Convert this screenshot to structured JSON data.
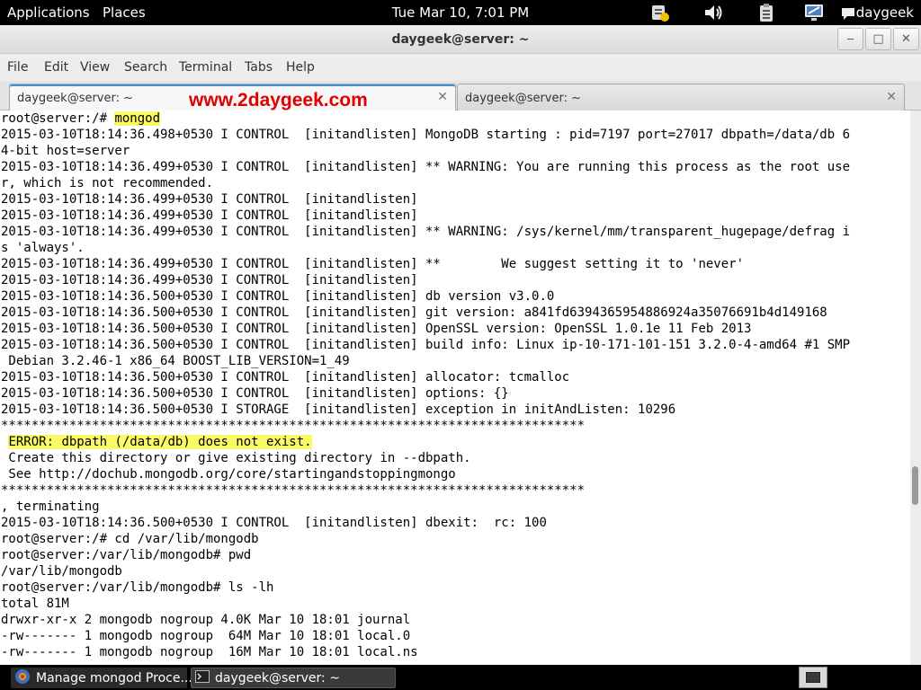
{
  "top_panel": {
    "applications": "Applications",
    "places": "Places",
    "clock": "Tue Mar 10,  7:01 PM",
    "user": "daygeek",
    "icons": [
      "notification-icon",
      "volume-icon",
      "clipboard-icon",
      "network-icon",
      "chat-icon"
    ]
  },
  "window": {
    "title": "daygeek@server: ~",
    "minimize": "‒",
    "maximize": "□",
    "close": "✕"
  },
  "menubar": [
    "File",
    "Edit",
    "View",
    "Search",
    "Terminal",
    "Tabs",
    "Help"
  ],
  "tabs": [
    {
      "label": "daygeek@server: ~",
      "close": "✕",
      "active": true
    },
    {
      "label": "daygeek@server: ~",
      "close": "✕",
      "active": false
    }
  ],
  "watermark": "www.2daygeek.com",
  "terminal": {
    "lines": [
      {
        "text": "root@server:/# ",
        "highlight": "mongod"
      },
      {
        "text": "2015-03-10T18:14:36.498+0530 I CONTROL  [initandlisten] MongoDB starting : pid=7197 port=27017 dbpath=/data/db 6"
      },
      {
        "text": "4-bit host=server"
      },
      {
        "text": "2015-03-10T18:14:36.499+0530 I CONTROL  [initandlisten] ** WARNING: You are running this process as the root use"
      },
      {
        "text": "r, which is not recommended."
      },
      {
        "text": "2015-03-10T18:14:36.499+0530 I CONTROL  [initandlisten]"
      },
      {
        "text": "2015-03-10T18:14:36.499+0530 I CONTROL  [initandlisten]"
      },
      {
        "text": "2015-03-10T18:14:36.499+0530 I CONTROL  [initandlisten] ** WARNING: /sys/kernel/mm/transparent_hugepage/defrag i"
      },
      {
        "text": "s 'always'."
      },
      {
        "text": "2015-03-10T18:14:36.499+0530 I CONTROL  [initandlisten] **        We suggest setting it to 'never'"
      },
      {
        "text": "2015-03-10T18:14:36.499+0530 I CONTROL  [initandlisten]"
      },
      {
        "text": "2015-03-10T18:14:36.500+0530 I CONTROL  [initandlisten] db version v3.0.0"
      },
      {
        "text": "2015-03-10T18:14:36.500+0530 I CONTROL  [initandlisten] git version: a841fd6394365954886924a35076691b4d149168"
      },
      {
        "text": "2015-03-10T18:14:36.500+0530 I CONTROL  [initandlisten] OpenSSL version: OpenSSL 1.0.1e 11 Feb 2013"
      },
      {
        "text": "2015-03-10T18:14:36.500+0530 I CONTROL  [initandlisten] build info: Linux ip-10-171-101-151 3.2.0-4-amd64 #1 SMP"
      },
      {
        "text": " Debian 3.2.46-1 x86_64 BOOST_LIB_VERSION=1_49"
      },
      {
        "text": "2015-03-10T18:14:36.500+0530 I CONTROL  [initandlisten] allocator: tcmalloc"
      },
      {
        "text": "2015-03-10T18:14:36.500+0530 I CONTROL  [initandlisten] options: {}"
      },
      {
        "text": "2015-03-10T18:14:36.500+0530 I STORAGE  [initandlisten] exception in initAndListen: 10296"
      },
      {
        "text": "*****************************************************************************"
      },
      {
        "text": " ",
        "highlight": "ERROR: dbpath (/data/db) does not exist."
      },
      {
        "text": " Create this directory or give existing directory in --dbpath."
      },
      {
        "text": " See http://dochub.mongodb.org/core/startingandstoppingmongo"
      },
      {
        "text": "*****************************************************************************"
      },
      {
        "text": ", terminating"
      },
      {
        "text": "2015-03-10T18:14:36.500+0530 I CONTROL  [initandlisten] dbexit:  rc: 100"
      },
      {
        "text": "root@server:/# cd /var/lib/mongodb"
      },
      {
        "text": "root@server:/var/lib/mongodb# pwd"
      },
      {
        "text": "/var/lib/mongodb"
      },
      {
        "text": "root@server:/var/lib/mongodb# ls -lh"
      },
      {
        "text": "total 81M"
      },
      {
        "text": "drwxr-xr-x 2 mongodb nogroup 4.0K Mar 10 18:01 journal"
      },
      {
        "text": "-rw------- 1 mongodb nogroup  64M Mar 10 18:01 local.0"
      },
      {
        "text": "-rw------- 1 mongodb nogroup  16M Mar 10 18:01 local.ns"
      }
    ],
    "scroll_position": 0.69,
    "scroll_visible_fraction": 0.07
  },
  "taskbar": {
    "tasks": [
      {
        "label": "Manage mongod Proce...",
        "icon": "browser-icon",
        "active": false
      },
      {
        "label": "daygeek@server: ~",
        "icon": "terminal-icon",
        "active": true
      }
    ]
  }
}
